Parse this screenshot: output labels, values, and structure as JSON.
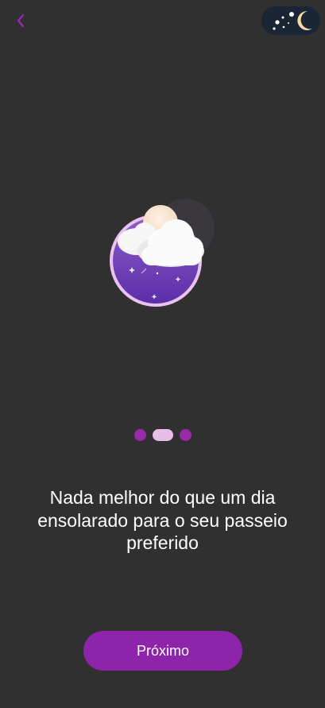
{
  "header": {
    "back_icon": "chevron-left-icon",
    "theme_toggle_icon": "moon-stars-icon",
    "theme_mode": "dark"
  },
  "hero": {
    "icon": "cloudy-night-icon"
  },
  "pager": {
    "total": 3,
    "active_index": 1
  },
  "message": {
    "text": "Nada melhor do que um dia ensolarado para o seu passeio preferido"
  },
  "actions": {
    "next_label": "Próximo"
  },
  "colors": {
    "background": "#303030",
    "accent": "#8e24aa",
    "dot_inactive": "#9b2aa9",
    "dot_active": "#e6bee8",
    "toggle_bg": "#1a2535"
  }
}
